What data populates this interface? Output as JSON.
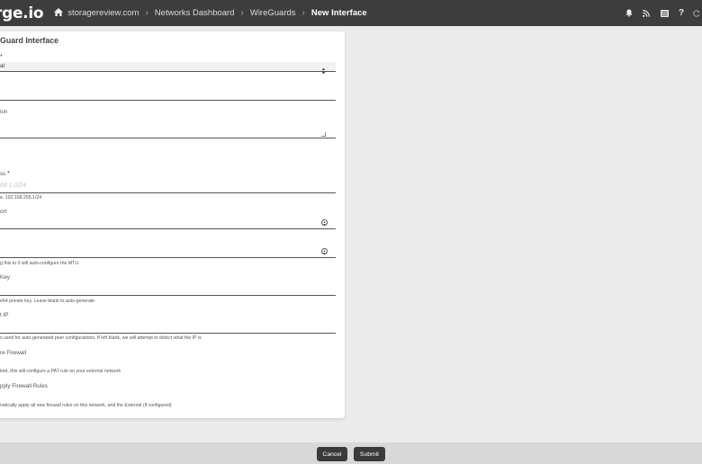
{
  "app": {
    "brand": "rge.io"
  },
  "breadcrumb": {
    "items": [
      "storagereview.com",
      "Networks Dashboard",
      "WireGuards"
    ],
    "current": "New Interface",
    "separator": "›"
  },
  "header_icons": [
    "bell-icon",
    "rss-icon",
    "list-icon",
    "help-icon",
    "refresh-icon"
  ],
  "form": {
    "title": "Guard Interface",
    "type": {
      "label": "*",
      "value": "al"
    },
    "description": {
      "label": "ion"
    },
    "ip_address": {
      "label": "ss",
      "required_mark": "*",
      "placeholder": "68.1.0/24",
      "hint": "e. 192.168.255.1/24"
    },
    "listen_port": {
      "label": "ort",
      "value": ""
    },
    "mtu": {
      "value": "",
      "hint": "g this to 0 will auto-configure the MTU"
    },
    "private_key": {
      "label": "Key",
      "hint": "e64 private key. Leave blank to auto-generate"
    },
    "endpoint_ip": {
      "label": "t IP",
      "hint": "s used for auto-generated peer configurations. If left blank, we will attempt to detect what the IP is"
    },
    "configure_firewall": {
      "label": "re Firewall",
      "hint": "ked, this will configure a PAT rule on your external network"
    },
    "apply_firewall_rules": {
      "label": "pply Firewall Rules",
      "hint": "natically apply all new firewall rules on this network, and the External (if configured)"
    }
  },
  "footer": {
    "cancel_label": "Cancel",
    "submit_label": "Submit"
  }
}
